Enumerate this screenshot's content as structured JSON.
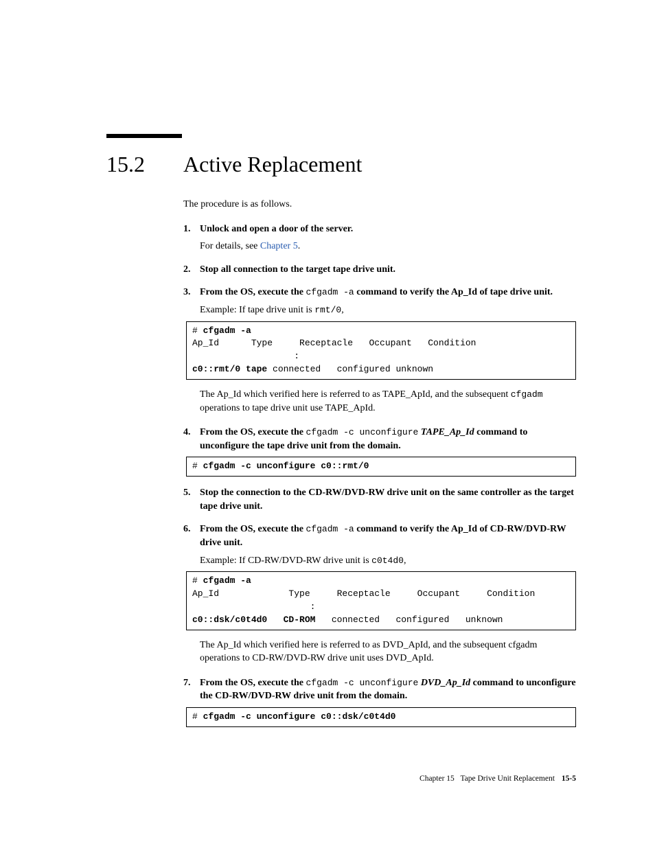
{
  "section": {
    "number": "15.2",
    "title": "Active Replacement"
  },
  "intro": "The procedure is as follows.",
  "steps": [
    {
      "title": "Unlock and open a door of the server.",
      "body_prefix": "For details, see ",
      "link": "Chapter 5",
      "body_suffix": "."
    },
    {
      "title": "Stop all connection to the target tape drive unit."
    },
    {
      "title_pre": "From the OS, execute the ",
      "title_code": "cfgadm -a",
      "title_post": " command to verify the Ap_Id of tape drive unit.",
      "example_pre": "Example: If tape drive unit is ",
      "example_code": "rmt/0",
      "example_post": ",",
      "code_lines": [
        {
          "pre": "# ",
          "bold": "cfgadm -a"
        },
        {
          "plain": "Ap_Id      Type     Receptacle   Occupant   Condition"
        },
        {
          "plain": "                   :"
        },
        {
          "bold": "c0::rmt/0 tape",
          "post": " connected   configured unknown"
        }
      ],
      "after_pre": "The Ap_Id which verified here is referred to as TAPE_ApId, and the subsequent ",
      "after_code": "cfgadm",
      "after_post": " operations to tape drive unit use TAPE_ApId."
    },
    {
      "title_pre": "From the OS, execute the ",
      "title_code": "cfgadm -c unconfigure",
      "title_italic": " TAPE_Ap_Id",
      "title_post": " command to unconfigure the tape drive unit from the domain.",
      "code_lines": [
        {
          "pre": "# ",
          "bold": "cfgadm -c unconfigure c0::rmt/0"
        }
      ]
    },
    {
      "title": "Stop the connection to the CD-RW/DVD-RW drive unit on the same controller as the target tape drive unit."
    },
    {
      "title_pre": "From the OS, execute the ",
      "title_code": "cfgadm -a",
      "title_post": " command to verify the Ap_Id of CD-RW/DVD-RW drive unit.",
      "example_pre": "Example: If CD-RW/DVD-RW drive unit is ",
      "example_code": "c0t4d0",
      "example_post": ",",
      "code_lines": [
        {
          "pre": "# ",
          "bold": "cfgadm -a"
        },
        {
          "plain": "Ap_Id             Type     Receptacle     Occupant     Condition"
        },
        {
          "plain": "                      :"
        },
        {
          "bold": "c0::dsk/c0t4d0   CD-ROM",
          "post": "   connected   configured   unknown"
        }
      ],
      "after_pre": "The Ap_Id which verified here is referred to as DVD_ApId, and the subsequent cfgadm operations to CD-RW/DVD-RW drive unit uses DVD_ApId."
    },
    {
      "title_pre": "From the OS, execute the ",
      "title_code": "cfgadm -c unconfigure",
      "title_italic": " DVD_Ap_Id",
      "title_post": " command to unconfigure the CD-RW/DVD-RW drive unit from the domain.",
      "code_lines": [
        {
          "pre": "# ",
          "bold": "cfgadm -c unconfigure c0::dsk/c0t4d0"
        }
      ]
    }
  ],
  "footer": {
    "chapter": "Chapter 15",
    "title": "Tape Drive Unit Replacement",
    "page": "15-5"
  }
}
